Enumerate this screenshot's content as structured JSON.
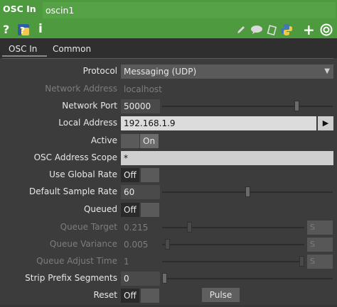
{
  "header": {
    "operator_type": "OSC In",
    "operator_name": "oscin1"
  },
  "toolbar": {
    "left_icons": [
      "help-icon",
      "python-help-icon",
      "info-icon"
    ],
    "right_icons": [
      "pencil-icon",
      "comment-icon",
      "clone-icon",
      "python-icon",
      "add-icon",
      "target-icon"
    ],
    "help_glyph": "?",
    "info_glyph": "i",
    "add_glyph": "+"
  },
  "tabs": [
    {
      "label": "OSC In",
      "active": true
    },
    {
      "label": "Common",
      "active": false
    }
  ],
  "params": {
    "protocol": {
      "label": "Protocol",
      "value": "Messaging (UDP)",
      "arrow": "▼"
    },
    "network_address": {
      "label": "Network Address",
      "value": "localhost"
    },
    "network_port": {
      "label": "Network Port",
      "value": "50000",
      "slider_fraction": 0.8
    },
    "local_address": {
      "label": "Local Address",
      "value": "192.168.1.9",
      "arrow": "▶"
    },
    "active": {
      "label": "Active",
      "value": "On"
    },
    "osc_address_scope": {
      "label": "OSC Address Scope",
      "value": "*"
    },
    "use_global_rate": {
      "label": "Use Global Rate",
      "value": "Off"
    },
    "default_sample_rate": {
      "label": "Default Sample Rate",
      "value": "60",
      "slider_fraction": 0.5
    },
    "queued": {
      "label": "Queued",
      "value": "Off"
    },
    "queue_target": {
      "label": "Queue Target",
      "value": "0.215",
      "button": "S",
      "slider_fraction": 0.18
    },
    "queue_variance": {
      "label": "Queue Variance",
      "value": "0.005",
      "button": "S",
      "slider_fraction": 0.02
    },
    "queue_adjust_time": {
      "label": "Queue Adjust Time",
      "value": "1",
      "button": "S",
      "slider_fraction": 1.0
    },
    "strip_prefix_segments": {
      "label": "Strip Prefix Segments",
      "value": "0",
      "slider_fraction": 0.0
    },
    "reset": {
      "label": "Reset",
      "value": "Off",
      "pulse_label": "Pulse"
    }
  },
  "colors": {
    "header_green": "#4e9a3f",
    "panel_bg": "#3c3c3c",
    "disabled_text": "#7d7d7d"
  }
}
